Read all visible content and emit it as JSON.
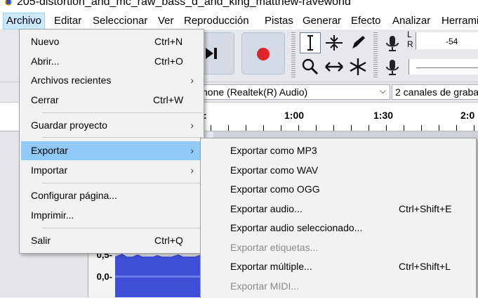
{
  "window": {
    "title": "205-distortion_and_mc_raw_bass_d_and_king_matthew-raveworld"
  },
  "menubar": {
    "items": [
      {
        "label": "Archivo"
      },
      {
        "label": "Editar"
      },
      {
        "label": "Seleccionar"
      },
      {
        "label": "Ver"
      },
      {
        "label": "Reproducción"
      },
      {
        "label": "Pistas"
      },
      {
        "label": "Generar"
      },
      {
        "label": "Efecto"
      },
      {
        "label": "Analizar"
      },
      {
        "label": "Herrami"
      }
    ]
  },
  "meter": {
    "left_label": "L",
    "right_label": "R",
    "value_label": "-54"
  },
  "devicebar": {
    "input_device": "hone (Realtek(R) Audio)",
    "channels": "2 canales de graba"
  },
  "ruler": {
    "ticks": [
      "1:00",
      "1:30",
      "2:0"
    ]
  },
  "track": {
    "scale": [
      "0,5-",
      "0,0-"
    ]
  },
  "archivo_menu": {
    "items": [
      {
        "label": "Nuevo",
        "shortcut": "Ctrl+N"
      },
      {
        "label": "Abrir...",
        "shortcut": "Ctrl+O"
      },
      {
        "label": "Archivos recientes",
        "submenu": "›"
      },
      {
        "label": "Cerrar",
        "shortcut": "Ctrl+W"
      },
      {
        "label": "Guardar proyecto",
        "submenu": "›"
      },
      {
        "label": "Exportar",
        "submenu": "›"
      },
      {
        "label": "Importar",
        "submenu": "›"
      },
      {
        "label": "Configurar página..."
      },
      {
        "label": "Imprimir..."
      },
      {
        "label": "Salir",
        "shortcut": "Ctrl+Q"
      }
    ]
  },
  "exportar_menu": {
    "items": [
      {
        "label": "Exportar como MP3"
      },
      {
        "label": "Exportar como WAV"
      },
      {
        "label": "Exportar como OGG"
      },
      {
        "label": "Exportar audio...",
        "shortcut": "Ctrl+Shift+E"
      },
      {
        "label": "Exportar audio seleccionado..."
      },
      {
        "label": "Exportar etiquetas..."
      },
      {
        "label": "Exportar múltiple...",
        "shortcut": "Ctrl+Shift+L"
      },
      {
        "label": "Exportar MIDI..."
      }
    ]
  },
  "colors": {
    "highlight": "#91c9f7",
    "record": "#e0242b",
    "waveform": "#3f4fd6"
  }
}
